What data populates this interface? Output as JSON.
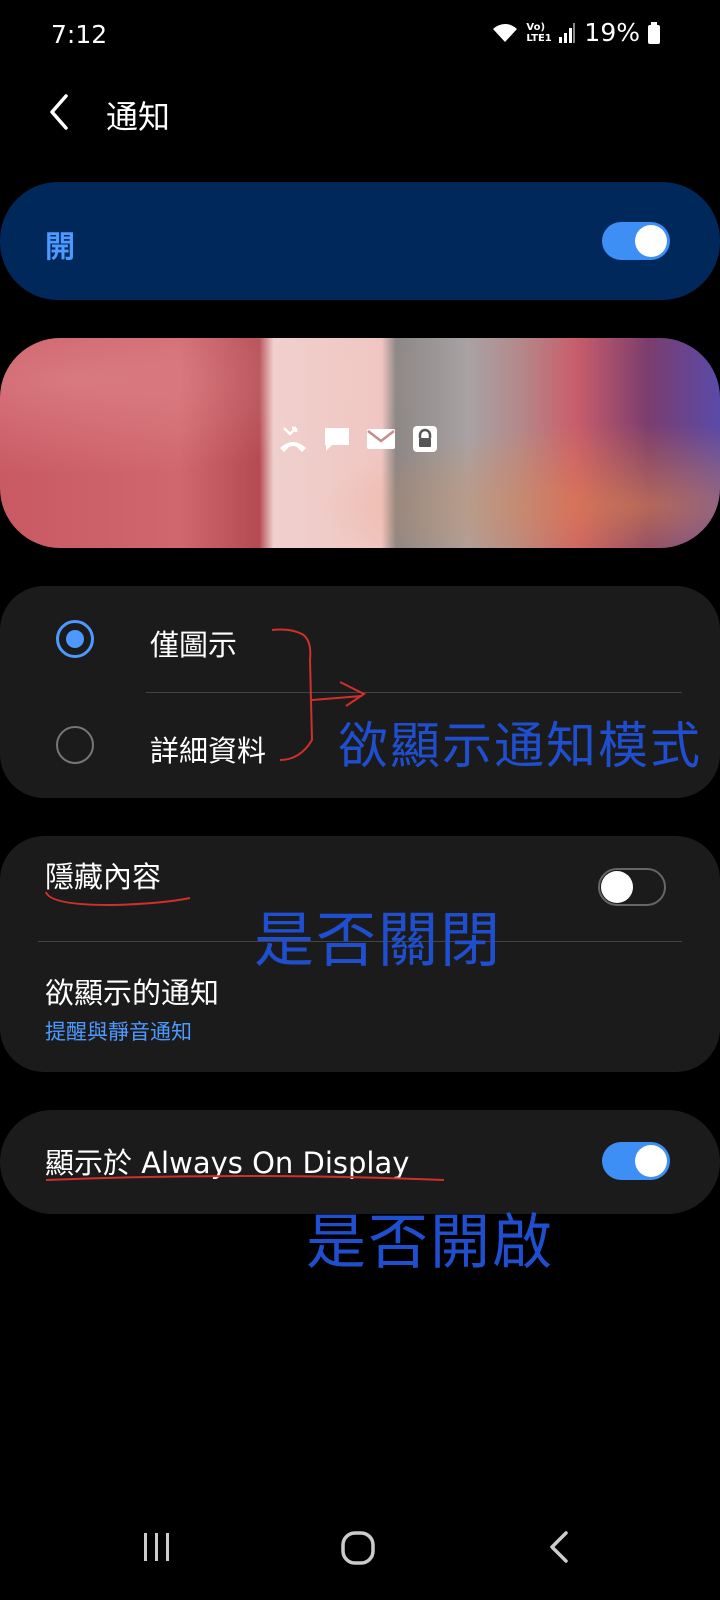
{
  "status_bar": {
    "time": "7:12",
    "network_label": "Vo) LTE1",
    "battery_percent": "19%"
  },
  "header": {
    "title": "通知"
  },
  "master_switch": {
    "label": "開",
    "on": true
  },
  "preview": {
    "icons": [
      "missed-call-icon",
      "message-icon",
      "mail-icon",
      "lock-icon"
    ]
  },
  "notification_style": {
    "options": [
      {
        "label": "僅圖示",
        "selected": true
      },
      {
        "label": "詳細資料",
        "selected": false
      }
    ]
  },
  "hide_content": {
    "label": "隱藏內容",
    "on": false
  },
  "notifications_to_show": {
    "title": "欲顯示的通知",
    "subtitle": "提醒與靜音通知"
  },
  "always_on_display": {
    "label": "顯示於 Always On Display",
    "on": true
  },
  "annotations": {
    "mode": "欲顯示通知模式",
    "close": "是否關閉",
    "open": "是否開啟"
  },
  "colors": {
    "accent": "#3e8ff5",
    "card_bg": "#1b1b1b",
    "master_bg": "#00285a",
    "annotation_blue": "#1f4fcf",
    "annotation_red": "#d0302a"
  }
}
